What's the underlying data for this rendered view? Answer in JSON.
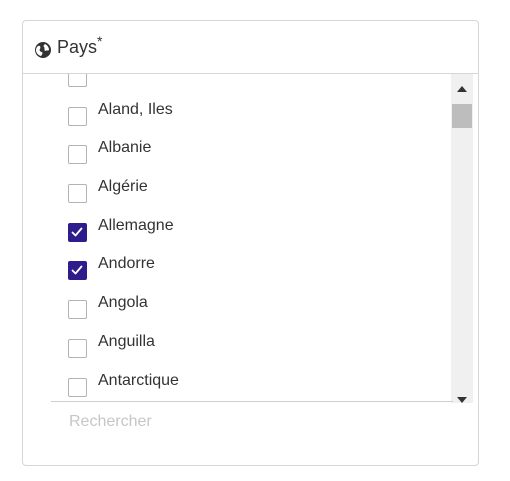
{
  "field": {
    "label": "Pays",
    "required_marker": "*",
    "icon": "globe-icon"
  },
  "countries": [
    {
      "label": "",
      "checked": false
    },
    {
      "label": "Aland, Iles",
      "checked": false
    },
    {
      "label": "Albanie",
      "checked": false
    },
    {
      "label": "Algérie",
      "checked": false
    },
    {
      "label": "Allemagne",
      "checked": true
    },
    {
      "label": "Andorre",
      "checked": true
    },
    {
      "label": "Angola",
      "checked": false
    },
    {
      "label": "Anguilla",
      "checked": false
    },
    {
      "label": "Antarctique",
      "checked": false
    }
  ],
  "search": {
    "placeholder": "Rechercher",
    "value": ""
  },
  "colors": {
    "checked": "#2f1c8c",
    "border": "#d6d6d6",
    "text": "#333333"
  }
}
